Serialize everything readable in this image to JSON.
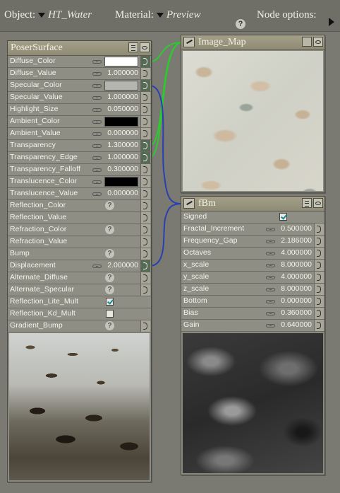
{
  "topbar": {
    "object_label": "Object:",
    "object_value": "HT_Water",
    "material_label": "Material:",
    "material_value": "Preview",
    "help_glyph": "?",
    "node_options_label": "Node options:"
  },
  "poser_surface": {
    "title": "PoserSurface",
    "rows": [
      {
        "label": "Diffuse_Color",
        "type": "color",
        "color": "#ffffff",
        "connected": true
      },
      {
        "label": "Diffuse_Value",
        "type": "value",
        "value": "1.000000",
        "connected": false
      },
      {
        "label": "Specular_Color",
        "type": "color",
        "color": "#b5b5b0",
        "connected": true
      },
      {
        "label": "Specular_Value",
        "type": "value",
        "value": "1.000000",
        "connected": false
      },
      {
        "label": "Highlight_Size",
        "type": "value",
        "value": "0.050000",
        "connected": false
      },
      {
        "label": "Ambient_Color",
        "type": "color",
        "color": "#000000",
        "connected": false
      },
      {
        "label": "Ambient_Value",
        "type": "value",
        "value": "0.000000",
        "connected": false
      },
      {
        "label": "Transparency",
        "type": "value",
        "value": "1.300000",
        "connected": true
      },
      {
        "label": "Transparency_Edge",
        "type": "value",
        "value": "1.000000",
        "connected": true
      },
      {
        "label": "Transparency_Falloff",
        "type": "value",
        "value": "0.300000",
        "connected": false
      },
      {
        "label": "Translucence_Color",
        "type": "color",
        "color": "#000000",
        "connected": false
      },
      {
        "label": "Translucence_Value",
        "type": "value",
        "value": "0.000000",
        "connected": false
      },
      {
        "label": "Reflection_Color",
        "type": "help",
        "connected": false
      },
      {
        "label": "Reflection_Value",
        "type": "empty",
        "connected": false
      },
      {
        "label": "Refraction_Color",
        "type": "help",
        "connected": false
      },
      {
        "label": "Refraction_Value",
        "type": "empty",
        "connected": false
      },
      {
        "label": "Bump",
        "type": "help",
        "connected": false
      },
      {
        "label": "Displacement",
        "type": "value",
        "value": "2.000000",
        "connected": true
      },
      {
        "label": "Alternate_Diffuse",
        "type": "help",
        "connected": false
      },
      {
        "label": "Alternate_Specular",
        "type": "help",
        "connected": false
      },
      {
        "label": "Reflection_Lite_Mult",
        "type": "check",
        "checked": true
      },
      {
        "label": "Reflection_Kd_Mult",
        "type": "check",
        "checked": false
      },
      {
        "label": "Gradient_Bump",
        "type": "help",
        "connected": false
      }
    ]
  },
  "image_map": {
    "title": "Image_Map"
  },
  "fbm": {
    "title": "fBm",
    "rows": [
      {
        "label": "Signed",
        "type": "check",
        "checked": true
      },
      {
        "label": "Fractal_Increment",
        "type": "value",
        "value": "0.500000"
      },
      {
        "label": "Frequency_Gap",
        "type": "value",
        "value": "2.186000"
      },
      {
        "label": "Octaves",
        "type": "value",
        "value": "4.000000"
      },
      {
        "label": "x_scale",
        "type": "value",
        "value": "8.000000"
      },
      {
        "label": "y_scale",
        "type": "value",
        "value": "4.000000"
      },
      {
        "label": "z_scale",
        "type": "value",
        "value": "8.000000"
      },
      {
        "label": "Bottom",
        "type": "value",
        "value": "0.000000"
      },
      {
        "label": "Bias",
        "type": "value",
        "value": "0.360000"
      },
      {
        "label": "Gain",
        "type": "value",
        "value": "0.640000"
      }
    ]
  },
  "colors": {
    "connector_green": "#2fc82f",
    "connector_blue": "#2a3fb0"
  }
}
